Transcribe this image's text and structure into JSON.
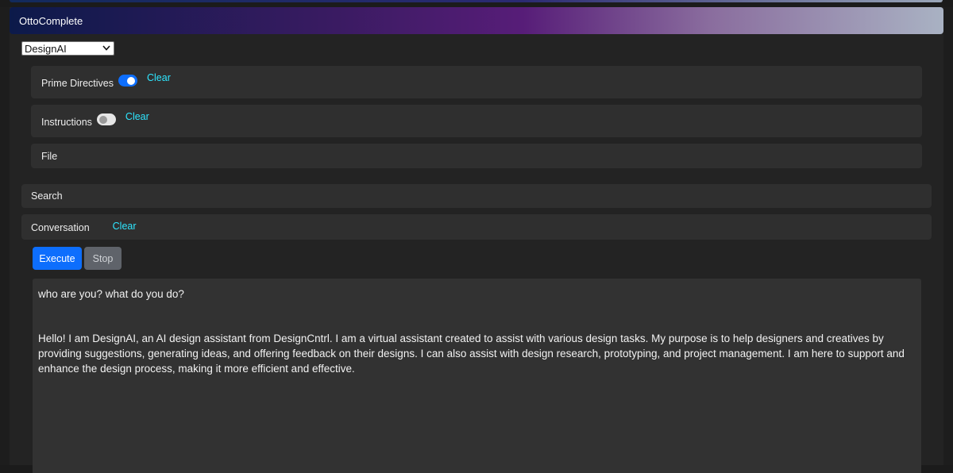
{
  "app": {
    "title": "OttoComplete"
  },
  "assistant_select": {
    "selected": "DesignAI"
  },
  "panels": {
    "prime_directives": {
      "label": "Prime Directives",
      "toggle": "on",
      "clear_label": "Clear"
    },
    "instructions": {
      "label": "Instructions",
      "toggle": "off",
      "clear_label": "Clear"
    },
    "file": {
      "label": "File"
    },
    "search": {
      "label": "Search"
    },
    "conversation": {
      "label": "Conversation",
      "clear_label": "Clear"
    }
  },
  "buttons": {
    "execute_label": "Execute",
    "stop_label": "Stop"
  },
  "conversation_log": {
    "user_message": "who are you? what do you do?",
    "assistant_message": "Hello! I am DesignAI, an AI design assistant from DesignCntrl. I am a virtual assistant created to assist with various design tasks. My purpose is to help designers and creatives by providing suggestions, generating ideas, and offering feedback on their designs. I can also assist with design research, prototyping, and project management. I am here to support and enhance the design process, making it more efficient and effective."
  },
  "colors": {
    "accent": "#0d6efd",
    "link": "#2ee6ff",
    "panel_bg": "#2f2f2f",
    "app_bg": "#232323"
  }
}
